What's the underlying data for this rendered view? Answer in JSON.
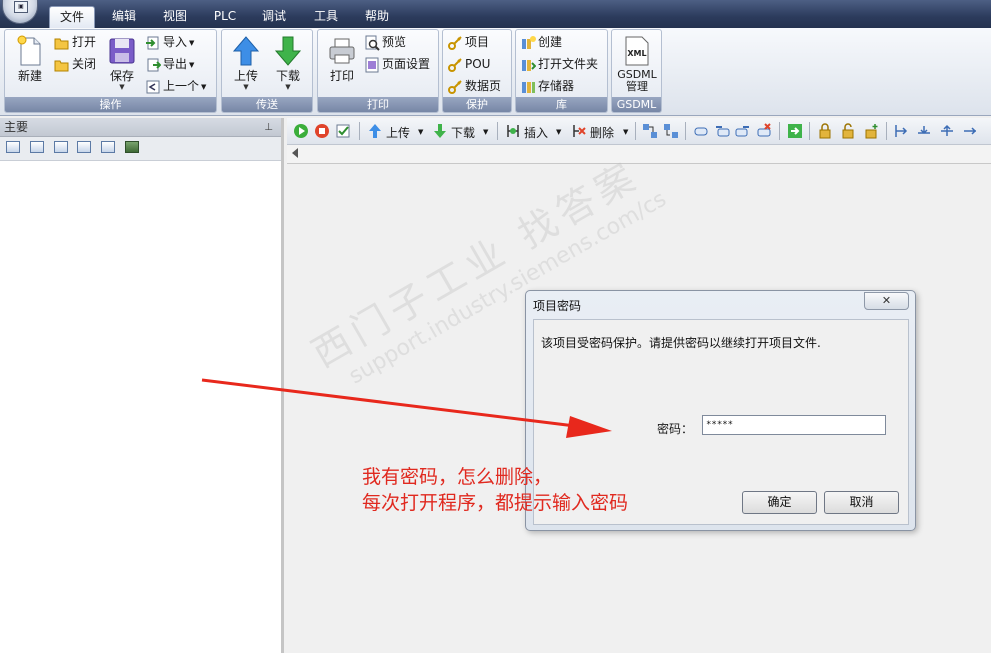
{
  "menu": {
    "tabs": [
      "文件",
      "编辑",
      "视图",
      "PLC",
      "调试",
      "工具",
      "帮助"
    ],
    "active_index": 0
  },
  "ribbon": {
    "operate": {
      "label": "操作",
      "new": "新建",
      "open": "打开",
      "close": "关闭",
      "save": "保存",
      "import": "导入",
      "export": "导出",
      "previous": "上一个"
    },
    "transfer": {
      "label": "传送",
      "upload": "上传",
      "download": "下载"
    },
    "print": {
      "label": "打印",
      "print": "打印",
      "preview": "预览",
      "page_setup": "页面设置"
    },
    "protect": {
      "label": "保护",
      "project": "项目",
      "pou": "POU",
      "data_page": "数据页"
    },
    "library": {
      "label": "库",
      "create": "创建",
      "open_folder": "打开文件夹",
      "memory": "存储器"
    },
    "gsdml": {
      "label": "GSDML",
      "manage": "GSDML 管理",
      "icon_text": "XML"
    }
  },
  "left_panel": {
    "title": "主要",
    "pin": "⊥"
  },
  "main_toolbar": {
    "upload": "上传",
    "download": "下载",
    "insert": "插入",
    "delete": "删除"
  },
  "watermark": {
    "line1": "西门子工业  找答案",
    "line2": "support.industry.siemens.com/cs"
  },
  "dialog": {
    "title": "项目密码",
    "close": "✕",
    "message": "该项目受密码保护。请提供密码以继续打开项目文件.",
    "password_label": "密码：",
    "password_value": "*****",
    "ok": "确定",
    "cancel": "取消"
  },
  "annotation": {
    "line1": "我有密码，怎么删除，",
    "line2": "每次打开程序，都提示输入密码",
    "color": "#e0291f"
  },
  "colors": {
    "titlebar": "#2c3b5c",
    "ribbon_group_label": "#7787a6",
    "workspace": "#f0f0f0"
  }
}
